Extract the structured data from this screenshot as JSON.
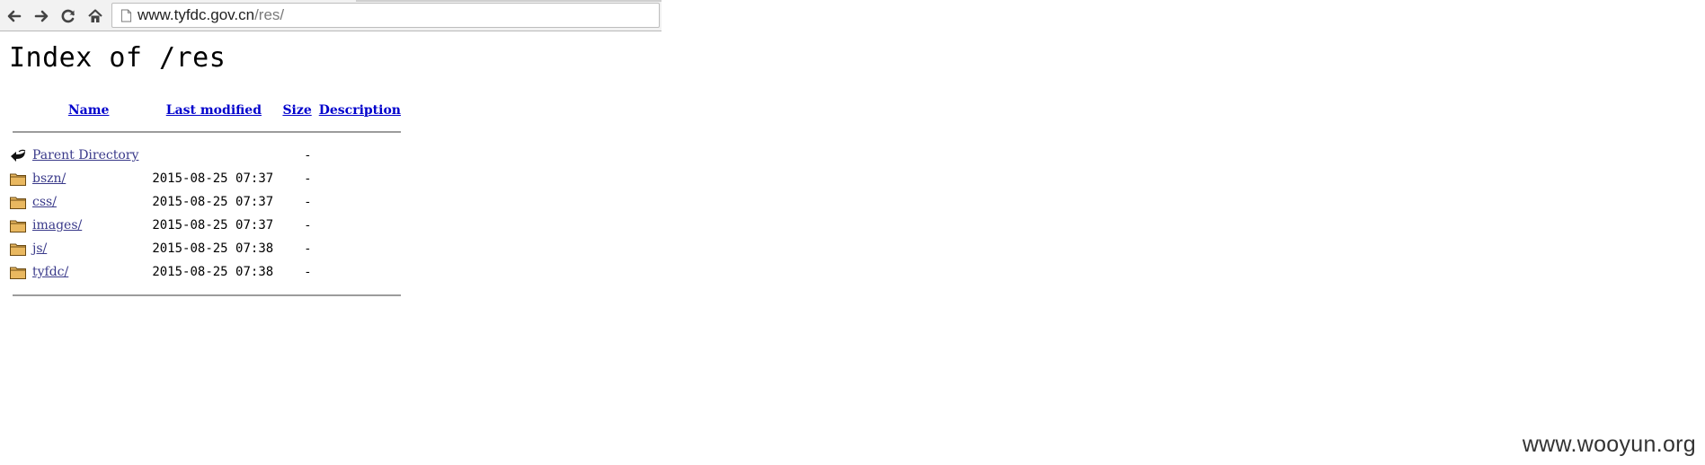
{
  "browser": {
    "url_host": "www.tyfdc.gov.cn",
    "url_path": "/res/",
    "icons": {
      "back": "back-arrow-icon",
      "forward": "forward-arrow-icon",
      "reload": "reload-icon",
      "home": "home-icon",
      "page": "page-icon"
    }
  },
  "page": {
    "title": "Index of /res",
    "headers": {
      "name": "Name",
      "last_modified": "Last modified",
      "size": "Size",
      "description": "Description"
    },
    "parent": {
      "label": "Parent Directory",
      "size": "-",
      "icon": "back-icon"
    },
    "entries": [
      {
        "name": "bszn/",
        "modified": "2015-08-25 07:37",
        "size": "-",
        "icon": "folder-icon"
      },
      {
        "name": "css/",
        "modified": "2015-08-25 07:37",
        "size": "-",
        "icon": "folder-icon"
      },
      {
        "name": "images/",
        "modified": "2015-08-25 07:37",
        "size": "-",
        "icon": "folder-icon"
      },
      {
        "name": "js/",
        "modified": "2015-08-25 07:38",
        "size": "-",
        "icon": "folder-icon"
      },
      {
        "name": "tyfdc/",
        "modified": "2015-08-25 07:38",
        "size": "-",
        "icon": "folder-icon"
      }
    ]
  },
  "watermark": "www.wooyun.org"
}
